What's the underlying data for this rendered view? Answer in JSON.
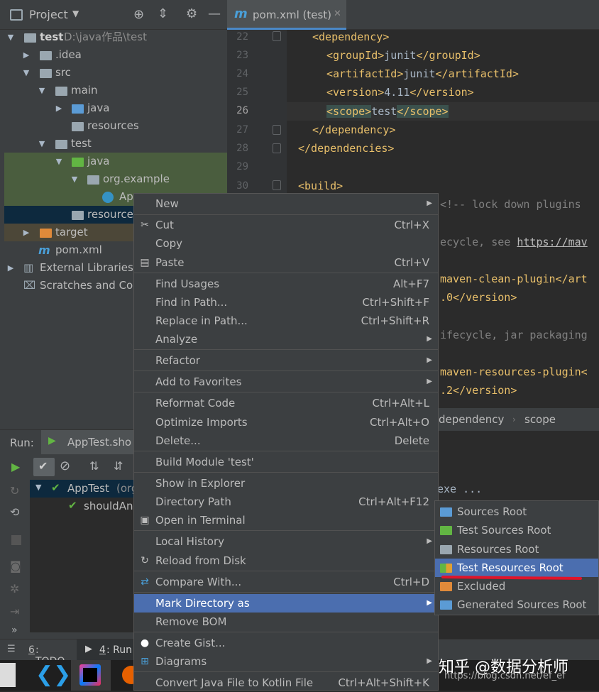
{
  "project_panel": {
    "title": "Project",
    "tree": [
      {
        "label": "test",
        "extra": "D:\\java作品\\test"
      },
      {
        "label": ".idea"
      },
      {
        "label": "src"
      },
      {
        "label": "main"
      },
      {
        "label": "java"
      },
      {
        "label": "resources"
      },
      {
        "label": "test"
      },
      {
        "label": "java"
      },
      {
        "label": "org.example"
      },
      {
        "label": "Ap"
      },
      {
        "label": "resource"
      },
      {
        "label": "target"
      },
      {
        "label": "pom.xml"
      },
      {
        "label": "External Libraries"
      },
      {
        "label": "Scratches and Con"
      }
    ]
  },
  "editor": {
    "tab_label": "pom.xml (test)",
    "line_numbers": [
      "22",
      "23",
      "24",
      "25",
      "26",
      "27",
      "28",
      "29",
      "30"
    ],
    "lines": [
      {
        "a": "<dependency>"
      },
      {
        "a": "<groupId>",
        "b": "junit",
        "c": "</groupId>"
      },
      {
        "a": "<artifactId>",
        "b": "junit",
        "c": "</artifactId>"
      },
      {
        "a": "<version>",
        "b": "4.11",
        "c": "</version>"
      },
      {
        "a": "<scope>",
        "b": "test",
        "c": "</scope>"
      },
      {
        "a": "</dependency>"
      },
      {
        "a": "</dependencies>"
      },
      {
        "a": ""
      },
      {
        "a": "<build>"
      }
    ],
    "partial_lines": [
      {
        "a": "<!-- lock down plugins"
      },
      {
        "a": "ecycle, see ",
        "link": "https://mav"
      },
      {
        "a": "maven-clean-plugin</art"
      },
      {
        "a": ".0</version>"
      },
      {
        "a": "ifecycle, jar packaging"
      },
      {
        "a": "maven-resources-plugin<"
      },
      {
        "a": ".2</version>"
      }
    ],
    "breadcrumb": [
      "dependency",
      "scope"
    ],
    "console_partial": "exe ..."
  },
  "run_panel": {
    "label": "Run:",
    "tab": "AppTest.sho",
    "items": [
      {
        "label": "AppTest",
        "extra": "(org"
      },
      {
        "label": "shouldAn"
      }
    ]
  },
  "tool_tabs": [
    {
      "num": "6",
      "label": ": TODO"
    },
    {
      "num": "4",
      "label": ": Run"
    }
  ],
  "context_menu": {
    "items": [
      {
        "label": "New",
        "shortcut": "",
        "submenu": true
      },
      {
        "label": "Cut",
        "shortcut": "Ctrl+X",
        "icon": "✂"
      },
      {
        "label": "Copy",
        "shortcut": ""
      },
      {
        "label": "Paste",
        "shortcut": "Ctrl+V",
        "icon": "📋"
      },
      {
        "label": "Find Usages",
        "shortcut": "Alt+F7"
      },
      {
        "label": "Find in Path...",
        "shortcut": "Ctrl+Shift+F"
      },
      {
        "label": "Replace in Path...",
        "shortcut": "Ctrl+Shift+R"
      },
      {
        "label": "Analyze",
        "shortcut": "",
        "submenu": true
      },
      {
        "label": "Refactor",
        "shortcut": "",
        "submenu": true
      },
      {
        "label": "Add to Favorites",
        "shortcut": "",
        "submenu": true
      },
      {
        "label": "Reformat Code",
        "shortcut": "Ctrl+Alt+L"
      },
      {
        "label": "Optimize Imports",
        "shortcut": "Ctrl+Alt+O"
      },
      {
        "label": "Delete...",
        "shortcut": "Delete"
      },
      {
        "label": "Build Module 'test'",
        "shortcut": ""
      },
      {
        "label": "Show in Explorer",
        "shortcut": ""
      },
      {
        "label": "Directory Path",
        "shortcut": "Ctrl+Alt+F12"
      },
      {
        "label": "Open in Terminal",
        "shortcut": ""
      },
      {
        "label": "Local History",
        "shortcut": "",
        "submenu": true
      },
      {
        "label": "Reload from Disk",
        "shortcut": ""
      },
      {
        "label": "Compare With...",
        "shortcut": "Ctrl+D"
      },
      {
        "label": "Mark Directory as",
        "shortcut": "",
        "submenu": true
      },
      {
        "label": "Remove BOM",
        "shortcut": ""
      },
      {
        "label": "Create Gist...",
        "shortcut": ""
      },
      {
        "label": "Diagrams",
        "shortcut": "",
        "submenu": true
      },
      {
        "label": "Convert Java File to Kotlin File",
        "shortcut": "Ctrl+Alt+Shift+K"
      }
    ]
  },
  "submenu": {
    "items": [
      {
        "label": "Sources Root",
        "color": "#5b9bd5"
      },
      {
        "label": "Test Sources Root",
        "color": "#62b543"
      },
      {
        "label": "Resources Root",
        "color": "#9aa7b0"
      },
      {
        "label": "Test Resources Root",
        "color": "#9aa7b0"
      },
      {
        "label": "Excluded",
        "color": "#e08a3a"
      },
      {
        "label": "Generated Sources Root",
        "color": "#5b9bd5"
      }
    ]
  },
  "watermark": {
    "line1": "知乎 @数据分析师",
    "line2": "https://blog.csdn.net/ef_ef"
  },
  "colors": {
    "accent": "#4b6eaf",
    "annotation_red": "#e0142a"
  }
}
